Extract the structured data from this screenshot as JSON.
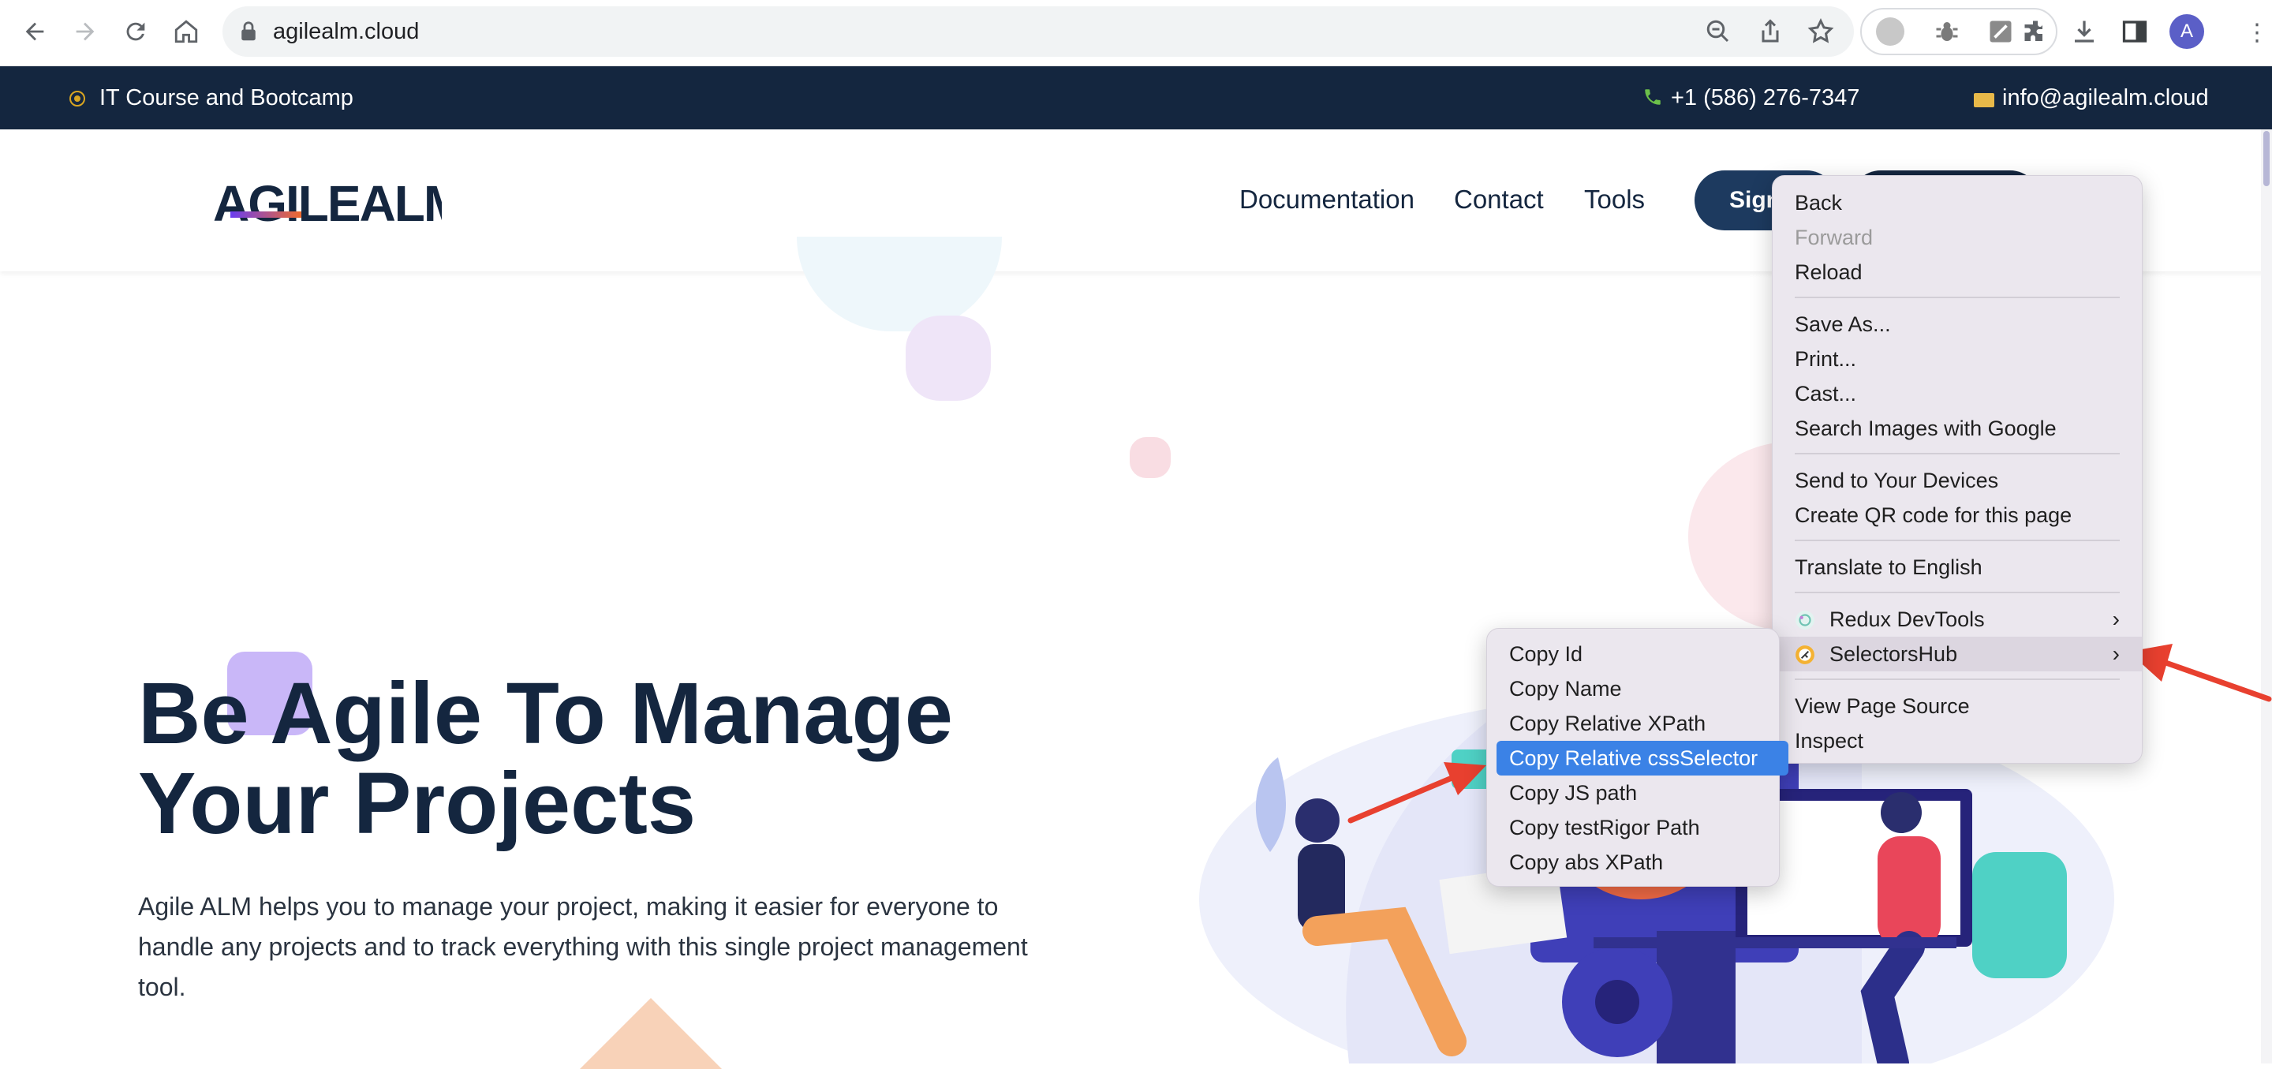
{
  "browser": {
    "url": "agilealm.cloud",
    "profile_initial": "A",
    "icons": [
      "back-icon",
      "forward-icon",
      "reload-icon",
      "home-icon",
      "lock-icon",
      "zoom-icon",
      "share-icon",
      "star-icon",
      "extension-icon",
      "download-icon",
      "side-panel-icon"
    ]
  },
  "topbar": {
    "tagline": "IT Course and Bootcamp",
    "phone": "+1 (586) 276-7347",
    "email": "info@agilealm.cloud"
  },
  "header": {
    "logo_text": "AGILEALM",
    "menu": [
      "Documentation",
      "Contact",
      "Tools"
    ],
    "signin_label": "Sign"
  },
  "hero": {
    "title_line1": "Be Agile To Manage",
    "title_line2": "Your Projects",
    "description": "Agile ALM helps you to manage your project, making it easier for everyone to handle any projects and to track everything with this single project management tool."
  },
  "context_menu": {
    "back": "Back",
    "forward": "Forward",
    "reload": "Reload",
    "save_as": "Save As...",
    "print": "Print...",
    "cast": "Cast...",
    "search_images": "Search Images with Google",
    "send_devices": "Send to Your Devices",
    "qr_code": "Create QR code for this page",
    "translate": "Translate to English",
    "redux": "Redux DevTools",
    "selectorshub": "SelectorsHub",
    "view_source": "View Page Source",
    "inspect": "Inspect"
  },
  "submenu": {
    "items": [
      "Copy Id",
      "Copy Name",
      "Copy Relative XPath",
      "Copy Relative cssSelector",
      "Copy JS path",
      "Copy testRigor Path",
      "Copy abs XPath"
    ],
    "active_index": 3
  },
  "colors": {
    "topbar_bg": "#14263f",
    "accent_blue": "#3b82e6",
    "annotation_arrow": "#e8402f"
  }
}
